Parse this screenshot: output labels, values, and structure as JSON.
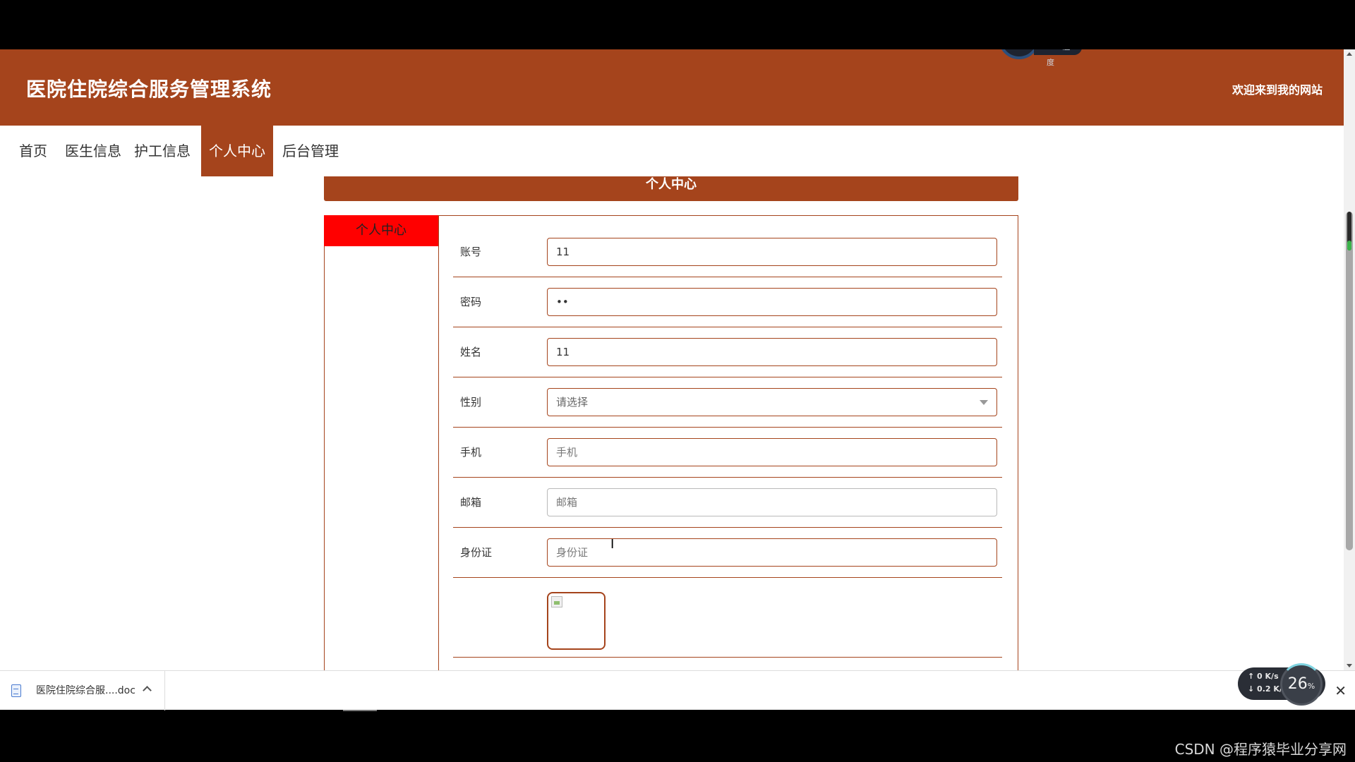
{
  "header": {
    "site_title": "医院住院综合服务管理系统",
    "welcome_text": "欢迎来到我的网站",
    "cpu_label": "CPU温度"
  },
  "nav": {
    "items": [
      {
        "label": "首页"
      },
      {
        "label": "医生信息"
      },
      {
        "label": "护工信息"
      },
      {
        "label": "个人中心"
      },
      {
        "label": "后台管理"
      }
    ],
    "active": "个人中心"
  },
  "section": {
    "title": "个人中心",
    "side_tab": "个人中心"
  },
  "form": {
    "account": {
      "label": "账号",
      "value": "11"
    },
    "password": {
      "label": "密码",
      "value": "••"
    },
    "name": {
      "label": "姓名",
      "value": "11"
    },
    "gender": {
      "label": "性别",
      "value": "请选择"
    },
    "phone": {
      "label": "手机",
      "placeholder": "手机"
    },
    "email": {
      "label": "邮箱",
      "placeholder": "邮箱"
    },
    "idcard": {
      "label": "身份证",
      "placeholder": "身份证"
    }
  },
  "download_bar": {
    "file_name": "医院住院综合服....doc",
    "close": "✕"
  },
  "net_widget": {
    "upload": "0 K/s",
    "download": "0.2 K/s",
    "percent": "26",
    "percent_unit": "%"
  },
  "watermark": "CSDN @程序猿毕业分享网"
}
